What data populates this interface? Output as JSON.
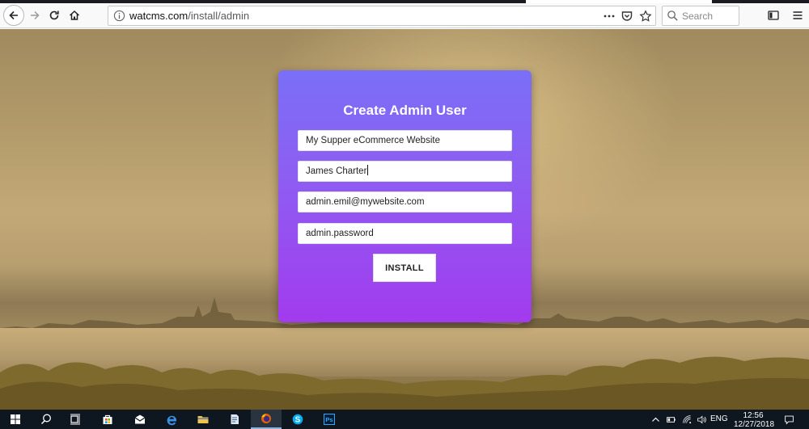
{
  "browser": {
    "url_host": "watcms.com",
    "url_path": "/install/admin",
    "search_placeholder": "Search"
  },
  "form": {
    "title": "Create Admin User",
    "site_name_value": "My Supper eCommerce Website",
    "full_name_value": "James Charter",
    "email_value": "admin.emil@mywebsite.com",
    "password_value": "admin.password",
    "install_label": "INSTALL"
  },
  "taskbar": {
    "language": "ENG",
    "time": "12:56",
    "date": "12/27/2018"
  },
  "colors": {
    "card_top": "#7a6ff7",
    "card_bottom": "#a23bee",
    "taskbar": "#0e1620"
  }
}
